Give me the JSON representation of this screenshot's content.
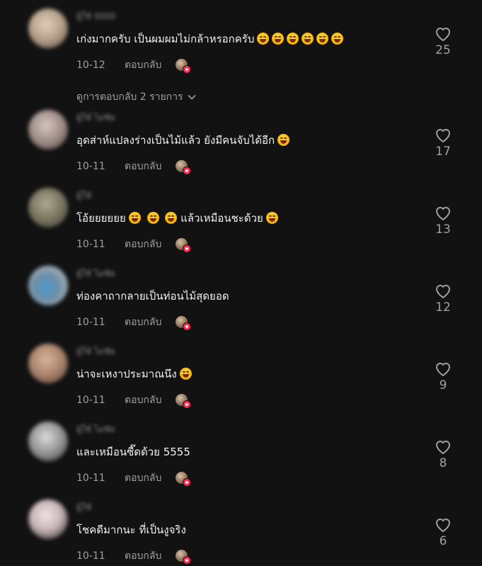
{
  "comments": [
    {
      "username": "ผู้ใช้ 0000",
      "text": "เก่งมากครับ เป็นผมผมไม่กล้าหรอกครับ",
      "emoji_count": 6,
      "date": "10-12",
      "reply_label": "ตอบกลับ",
      "likes": "25",
      "avatar_color": "#b8a48e",
      "view_replies_label": "ดูการตอบกลับ 2 รายการ"
    },
    {
      "username": "ผู้ใช้ ไม่ชัด",
      "text": "อุดส่าห์แปลงร่างเป็นไม้แล้ว ยังมีคนจับได้อีก",
      "emoji_count": 1,
      "date": "10-11",
      "reply_label": "ตอบกลับ",
      "likes": "17",
      "avatar_color": "#9e8c86"
    },
    {
      "username": "ผู้ใช้",
      "text": "โอ้ยยยยยย",
      "text_suffix": "แล้วเหมือนชะด้วย",
      "emoji_count": 3,
      "suffix_emoji_count": 1,
      "date": "10-11",
      "reply_label": "ตอบกลับ",
      "likes": "13",
      "avatar_color": "#7a7460"
    },
    {
      "username": "ผู้ใช้ ไม่ชัด",
      "text": "ท่องคาถากลายเป็นท่อนไม้สุดยอด",
      "emoji_count": 0,
      "date": "10-11",
      "reply_label": "ตอบกลับ",
      "likes": "12",
      "avatar_color": "#6f8ea4"
    },
    {
      "username": "ผู้ใช้ ไม่ชัด",
      "text": "น่าจะเหงาประมาณนึง",
      "emoji_count": 1,
      "date": "10-11",
      "reply_label": "ตอบกลับ",
      "likes": "9",
      "avatar_color": "#a8826a"
    },
    {
      "username": "ผู้ใช้ ไม่ชัด",
      "text": "และเหมือนซี๊ดด้วย 5555",
      "emoji_count": 0,
      "date": "10-11",
      "reply_label": "ตอบกลับ",
      "likes": "8",
      "avatar_color": "#8a8a8a"
    },
    {
      "username": "ผู้ใช้",
      "text": "โชคดีมากนะ ที่เป็นงูจริง",
      "emoji_count": 0,
      "date": "10-11",
      "reply_label": "ตอบกลับ",
      "likes": "6",
      "avatar_color": "#c9b6b8"
    }
  ],
  "colors": {
    "background": "#121212",
    "text_primary": "#f1f1f2",
    "text_secondary": "#a0a0a2",
    "accent": "#fe2c55"
  }
}
